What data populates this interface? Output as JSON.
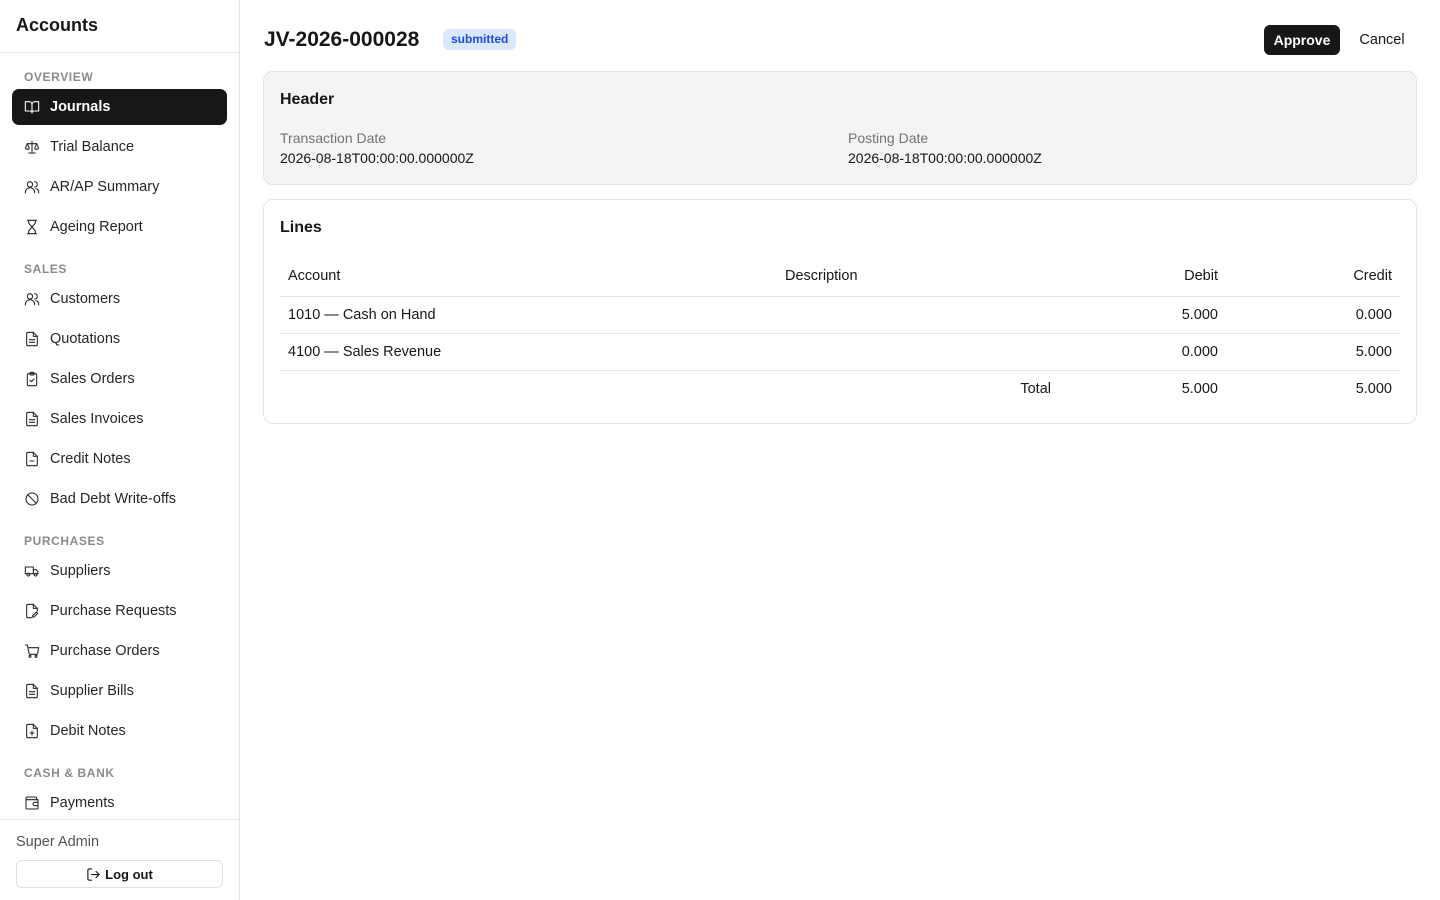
{
  "app": {
    "title": "Accounts"
  },
  "sidebar": {
    "sections": [
      {
        "label": "OVERVIEW"
      },
      {
        "label": "SALES"
      },
      {
        "label": "PURCHASES"
      },
      {
        "label": "CASH & BANK"
      }
    ],
    "items": [
      {
        "label": "Journals",
        "icon": "book-open-icon",
        "active": true
      },
      {
        "label": "Trial Balance",
        "icon": "scale-icon"
      },
      {
        "label": "AR/AP Summary",
        "icon": "users-icon"
      },
      {
        "label": "Ageing Report",
        "icon": "hourglass-icon"
      },
      {
        "label": "Customers",
        "icon": "users-icon"
      },
      {
        "label": "Quotations",
        "icon": "file-text-icon"
      },
      {
        "label": "Sales Orders",
        "icon": "clipboard-check-icon"
      },
      {
        "label": "Sales Invoices",
        "icon": "file-text-icon"
      },
      {
        "label": "Credit Notes",
        "icon": "file-minus-icon"
      },
      {
        "label": "Bad Debt Write-offs",
        "icon": "ban-icon"
      },
      {
        "label": "Suppliers",
        "icon": "truck-icon"
      },
      {
        "label": "Purchase Requests",
        "icon": "file-pen-icon"
      },
      {
        "label": "Purchase Orders",
        "icon": "shopping-cart-icon"
      },
      {
        "label": "Supplier Bills",
        "icon": "file-text-icon"
      },
      {
        "label": "Debit Notes",
        "icon": "file-plus-icon"
      },
      {
        "label": "Payments",
        "icon": "wallet-icon"
      }
    ],
    "footer": {
      "user": "Super Admin",
      "logout_label": "Log out"
    }
  },
  "page": {
    "title": "JV-2026-000028",
    "status": "submitted",
    "actions": {
      "approve": "Approve",
      "cancel": "Cancel"
    }
  },
  "header_card": {
    "title": "Header",
    "fields": [
      {
        "label": "Transaction Date",
        "value": "2026-08-18T00:00:00.000000Z"
      },
      {
        "label": "Posting Date",
        "value": "2026-08-18T00:00:00.000000Z"
      }
    ]
  },
  "lines_card": {
    "title": "Lines",
    "columns": [
      "Account",
      "Description",
      "Debit",
      "Credit"
    ],
    "rows": [
      {
        "account": "1010 — Cash on Hand",
        "description": "",
        "debit": "5.000",
        "credit": "0.000"
      },
      {
        "account": "4100 — Sales Revenue",
        "description": "",
        "debit": "0.000",
        "credit": "5.000"
      }
    ],
    "total": {
      "label": "Total",
      "debit": "5.000",
      "credit": "5.000"
    }
  },
  "colors": {
    "active_nav_bg": "#171717",
    "badge_bg": "#dbe7fb",
    "badge_text": "#1d4ed8",
    "header_card_bg": "#f4f4f4"
  }
}
